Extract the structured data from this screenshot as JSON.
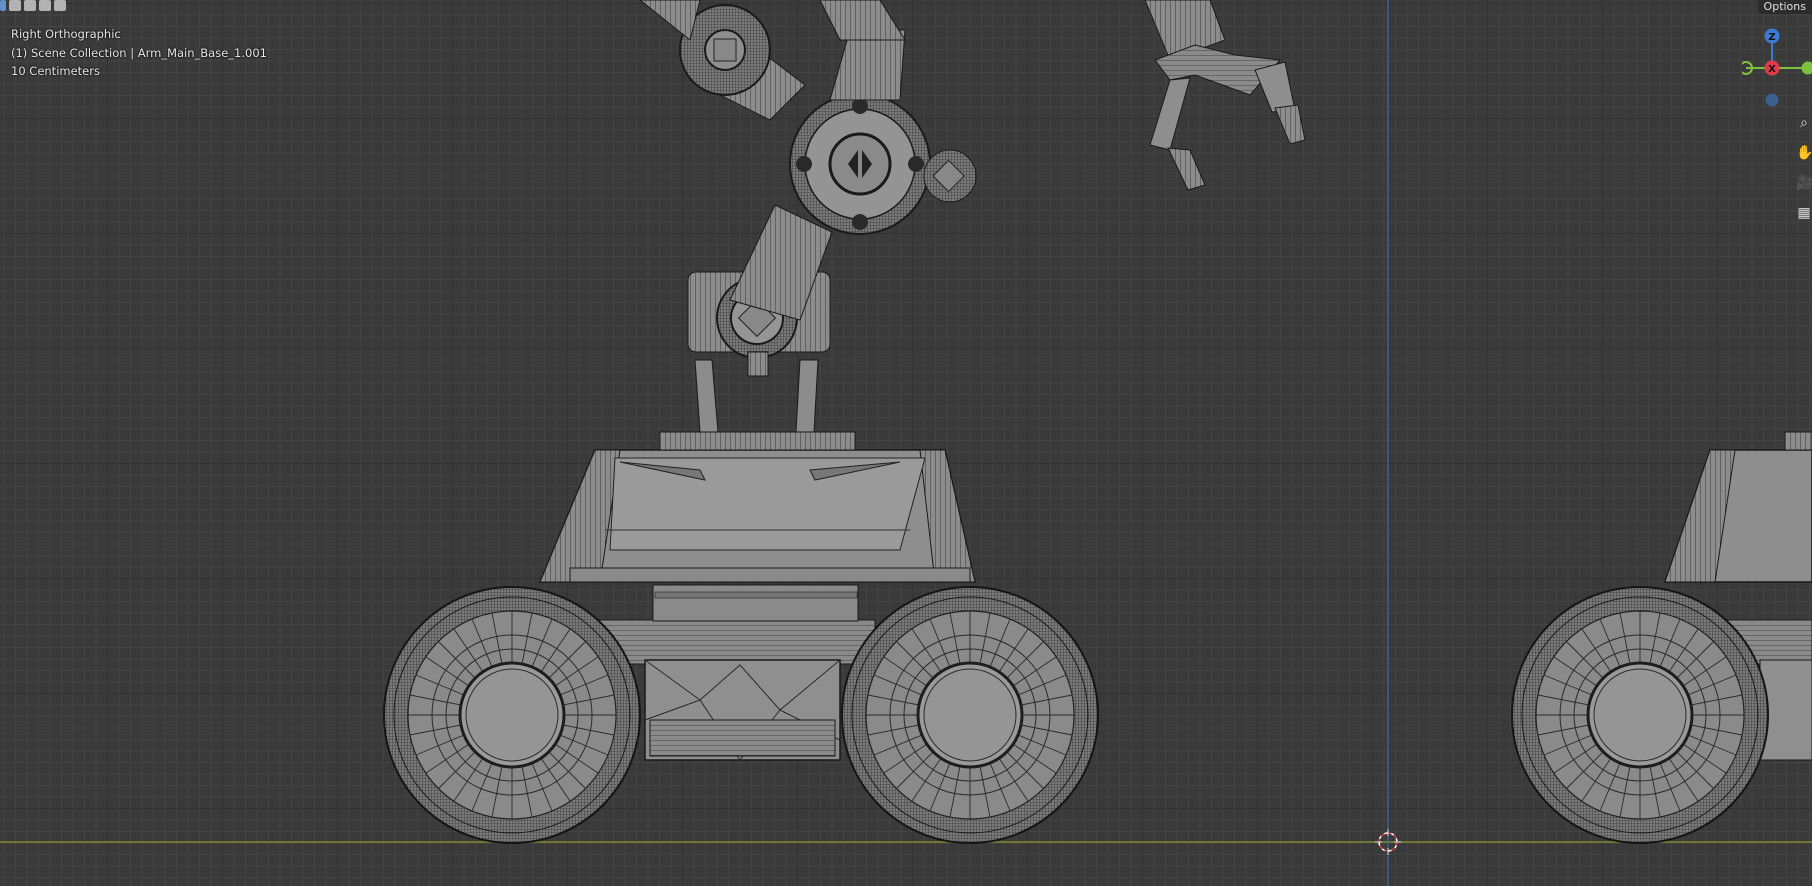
{
  "viewport": {
    "view_name": "Right Orthographic",
    "collection_line": "(1) Scene Collection | Arm_Main_Base_1.001",
    "grid_scale": "10 Centimeters"
  },
  "header": {
    "options_label": "Options"
  },
  "axes_gizmo": {
    "z_label": "Z",
    "x_label": "X",
    "colors": {
      "z": "#3b7bd4",
      "x": "#e23a4a",
      "y": "#7cc23a"
    }
  },
  "nav_tools": [
    {
      "icon": "zoom-icon",
      "glyph": "⌕"
    },
    {
      "icon": "hand-icon",
      "glyph": "✋"
    },
    {
      "icon": "camera-icon",
      "glyph": "🎥"
    },
    {
      "icon": "grid-icon",
      "glyph": "▦"
    }
  ],
  "colors": {
    "background": "#393939",
    "grid_minor": "#444444",
    "grid_major": "#323232",
    "horizon_line": "#8a9a2a",
    "vertical_axis": "#3a6ea0",
    "mesh_fill": "#8c8c8c",
    "wire": "#1a1a1a"
  }
}
